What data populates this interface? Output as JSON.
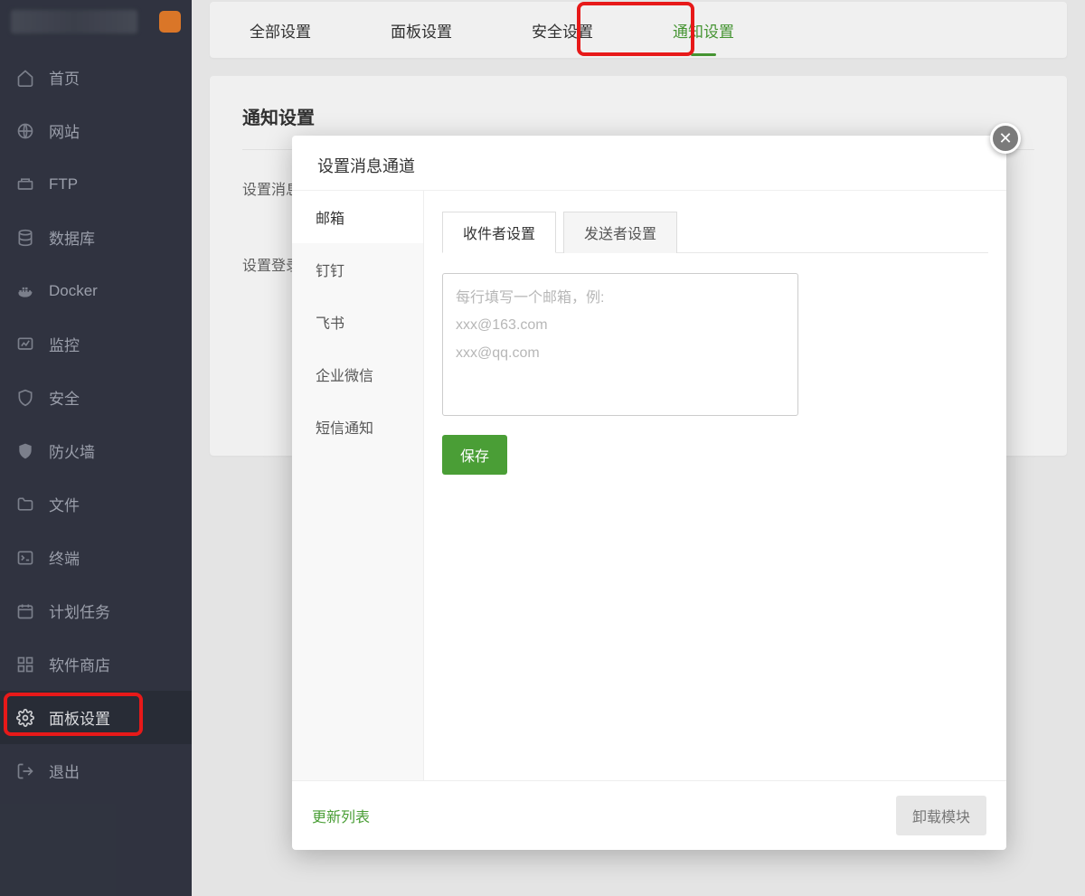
{
  "sidebar": {
    "items": [
      {
        "label": "首页"
      },
      {
        "label": "网站"
      },
      {
        "label": "FTP"
      },
      {
        "label": "数据库"
      },
      {
        "label": "Docker"
      },
      {
        "label": "监控"
      },
      {
        "label": "安全"
      },
      {
        "label": "防火墙"
      },
      {
        "label": "文件"
      },
      {
        "label": "终端"
      },
      {
        "label": "计划任务"
      },
      {
        "label": "软件商店"
      },
      {
        "label": "面板设置"
      },
      {
        "label": "退出"
      }
    ]
  },
  "tabs": {
    "items": [
      {
        "label": "全部设置"
      },
      {
        "label": "面板设置"
      },
      {
        "label": "安全设置"
      },
      {
        "label": "通知设置"
      }
    ]
  },
  "panel": {
    "title": "通知设置",
    "rows": [
      {
        "label": "设置消息"
      },
      {
        "label": "设置登录"
      }
    ]
  },
  "modal": {
    "title": "设置消息通道",
    "side": [
      {
        "label": "邮箱"
      },
      {
        "label": "钉钉"
      },
      {
        "label": "飞书"
      },
      {
        "label": "企业微信"
      },
      {
        "label": "短信通知"
      }
    ],
    "sub_tabs": [
      {
        "label": "收件者设置"
      },
      {
        "label": "发送者设置"
      }
    ],
    "textarea_placeholder": "每行填写一个邮箱，例:\nxxx@163.com\nxxx@qq.com",
    "save": "保存",
    "refresh": "更新列表",
    "uninstall": "卸载模块"
  }
}
